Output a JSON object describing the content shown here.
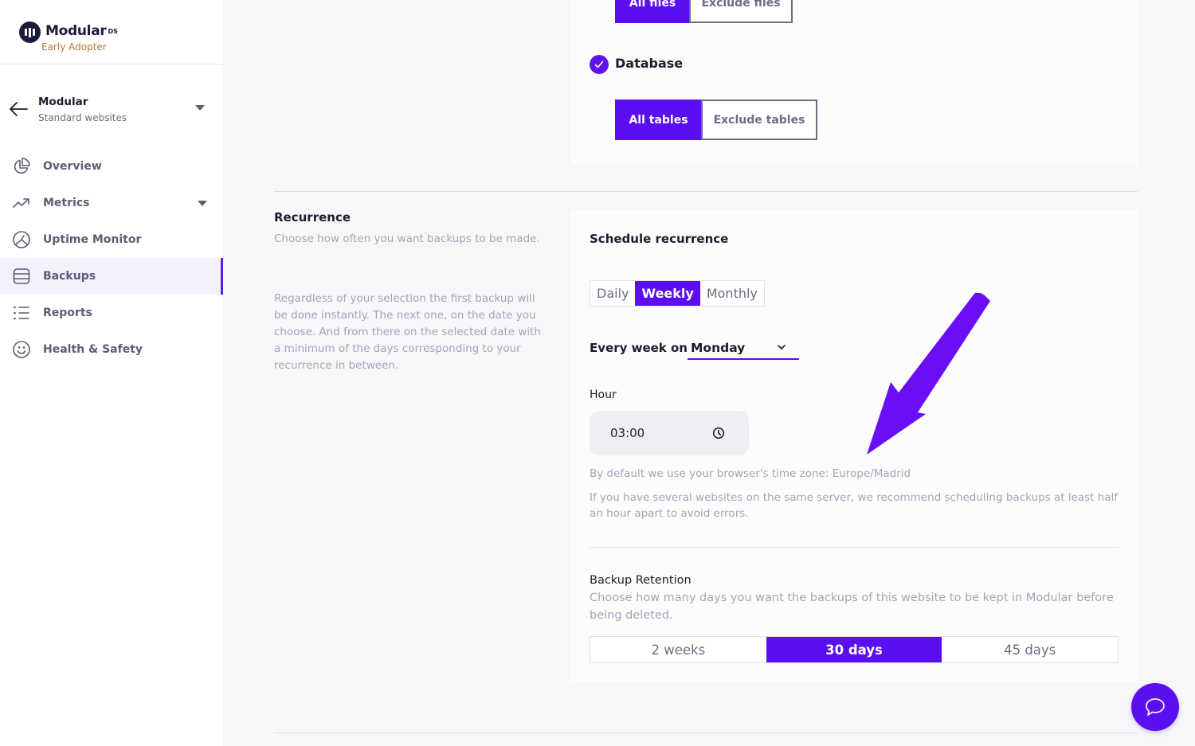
{
  "brand": {
    "name": "Modular",
    "suffix": "DS",
    "badge": "Early Adopter",
    "badge_color": "#b6783a"
  },
  "project": {
    "name": "Modular",
    "subtitle": "Standard websites"
  },
  "sidebar": {
    "items": [
      {
        "label": "Overview",
        "icon": "pie-chart-icon",
        "active": false
      },
      {
        "label": "Metrics",
        "icon": "trending-up-icon",
        "active": false,
        "has_submenu": true
      },
      {
        "label": "Uptime Monitor",
        "icon": "gauge-icon",
        "active": false
      },
      {
        "label": "Backups",
        "icon": "database-icon",
        "active": true
      },
      {
        "label": "Reports",
        "icon": "list-icon",
        "active": false
      },
      {
        "label": "Health & Safety",
        "icon": "smile-icon",
        "active": false
      }
    ]
  },
  "files": {
    "options": [
      "All files",
      "Exclude files"
    ],
    "selected": "All files"
  },
  "database": {
    "label": "Database",
    "checked": true,
    "options": [
      "All tables",
      "Exclude tables"
    ],
    "selected": "All tables"
  },
  "recurrence": {
    "title": "Recurrence",
    "description": "Choose how often you want backups to be made.",
    "note": "Regardless of your selection the first backup will be done instantly. The next one, on the date you choose. And from there on the selected date with a minimum of the days corresponding to your recurrence in between.",
    "card_title": "Schedule recurrence",
    "frequency_options": [
      "Daily",
      "Weekly",
      "Monthly"
    ],
    "frequency_selected": "Weekly",
    "every_week_label": "Every week on",
    "day_value": "Monday",
    "hour_label": "Hour",
    "hour_value": "03:00",
    "timezone_note": "By default we use your browser's time zone: Europe/Madrid",
    "server_note": "If you have several websites on the same server, we recommend scheduling backups at least half an hour apart to avoid errors."
  },
  "retention": {
    "title": "Backup Retention",
    "description": "Choose how many days you want the backups of this website to be kept in Modular before being deleted.",
    "options": [
      "2 weeks",
      "30 days",
      "45 days"
    ],
    "selected": "30 days"
  },
  "colors": {
    "accent": "#5b0ff0",
    "annotation_arrow": "#6a0ff5"
  },
  "chat": {
    "icon": "chat-bubble-icon"
  }
}
